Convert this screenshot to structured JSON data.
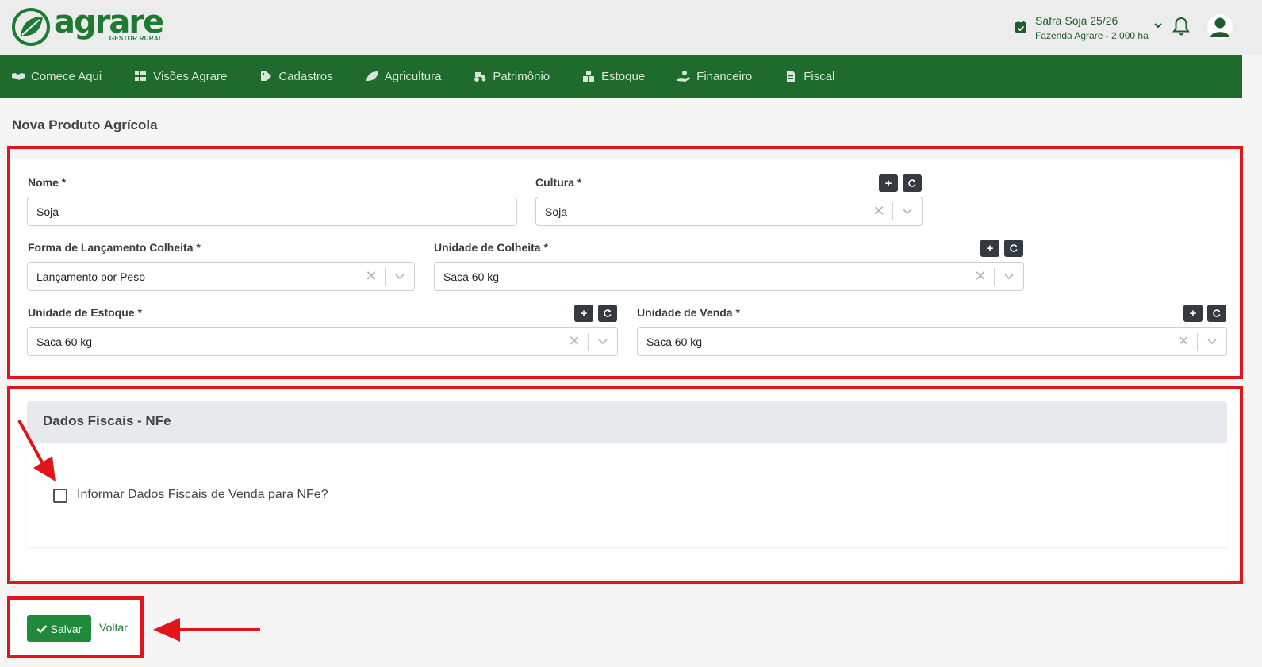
{
  "header": {
    "logo_name": "agrare",
    "logo_subtitle": "GESTOR RURAL",
    "safra_title": "Safra Soja 25/26",
    "safra_subtitle": "Fazenda Agrare - 2.000 ha",
    "icons": [
      "calendar-check-icon",
      "chevron-down-icon",
      "bell-icon",
      "user-icon"
    ]
  },
  "nav": {
    "items": [
      {
        "label": "Comece Aqui",
        "icon": "handshake-icon"
      },
      {
        "label": "Visões Agrare",
        "icon": "grid-icon"
      },
      {
        "label": "Cadastros",
        "icon": "tag-icon"
      },
      {
        "label": "Agricultura",
        "icon": "leaf-icon"
      },
      {
        "label": "Patrimônio",
        "icon": "tractor-icon"
      },
      {
        "label": "Estoque",
        "icon": "boxes-icon"
      },
      {
        "label": "Financeiro",
        "icon": "hand-money-icon"
      },
      {
        "label": "Fiscal",
        "icon": "document-icon"
      }
    ]
  },
  "page": {
    "title": "Nova Produto Agrícola"
  },
  "form": {
    "nome": {
      "label": "Nome *",
      "value": "Soja"
    },
    "cultura": {
      "label": "Cultura *",
      "value": "Soja"
    },
    "forma_lancamento": {
      "label": "Forma de Lançamento Colheita *",
      "value": "Lançamento por Peso"
    },
    "unidade_colheita": {
      "label": "Unidade de Colheita *",
      "value": "Saca 60 kg"
    },
    "unidade_estoque": {
      "label": "Unidade de Estoque *",
      "value": "Saca 60 kg"
    },
    "unidade_venda": {
      "label": "Unidade de Venda *",
      "value": "Saca 60 kg"
    },
    "add_symbol": "+",
    "clear_symbol": "✕"
  },
  "fiscal": {
    "title": "Dados Fiscais - NFe",
    "checkbox_label": "Informar Dados Fiscais de Venda para NFe?",
    "checked": false
  },
  "actions": {
    "save_label": "Salvar",
    "back_label": "Voltar"
  },
  "colors": {
    "brand_green": "#1f6a2d",
    "save_green": "#1f8b3a",
    "annotation_red": "#e0141b"
  }
}
